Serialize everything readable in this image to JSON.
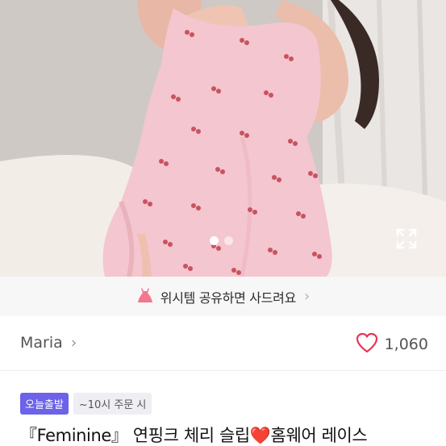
{
  "gallery": {
    "image_icon": "photo-of-pink-cherry-print-slip-dress",
    "dots": [
      {
        "active": true
      },
      {
        "active": false
      }
    ],
    "expand_icon": "expand-icon"
  },
  "wishlist_banner": {
    "icon": "pink-dress-icon",
    "label": "위시템 공유하면 사드려요",
    "chevron": "›"
  },
  "seller": {
    "name": "Maria",
    "chevron": "›"
  },
  "likes": {
    "icon": "heart-outline-icon",
    "count": "1,060",
    "color": "#e8335a"
  },
  "badges": {
    "delivery": "오늘출발",
    "note": "~10시 주문 시",
    "accent": "#6c63e8"
  },
  "product": {
    "title_before": "『Feminine』 연핑크 체리 슬립",
    "title_heart": "❤️",
    "title_after": "홈웨어 레이스"
  }
}
